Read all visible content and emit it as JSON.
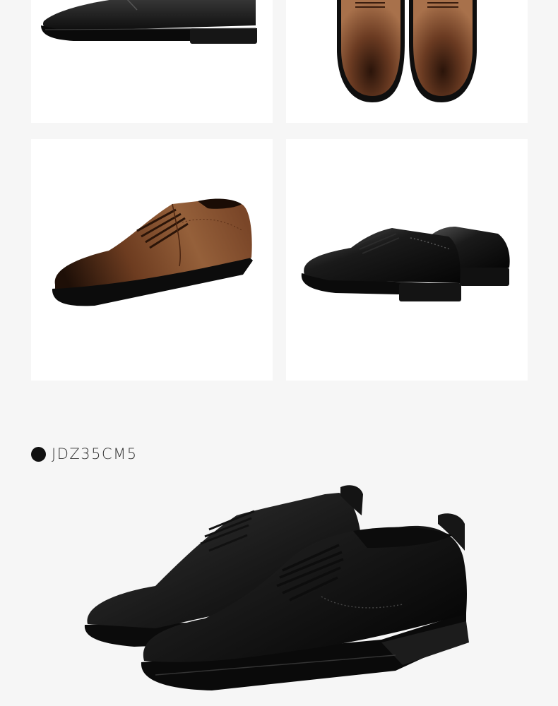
{
  "product": {
    "model_code": "JDZ35CM5"
  },
  "gallery": [
    {
      "name": "black-oxford-side-view",
      "color": "#111111"
    },
    {
      "name": "brown-oxford-top-view",
      "color": "#6b3b22"
    },
    {
      "name": "brown-oxford-angle-view",
      "color": "#7a4628"
    },
    {
      "name": "black-oxford-pair-view",
      "color": "#0f0f0f"
    }
  ],
  "colors": {
    "page_bg": "#f6f6f6",
    "card_bg": "#ffffff",
    "black_leather": "#141414",
    "brown_leather": "#7a4628"
  }
}
